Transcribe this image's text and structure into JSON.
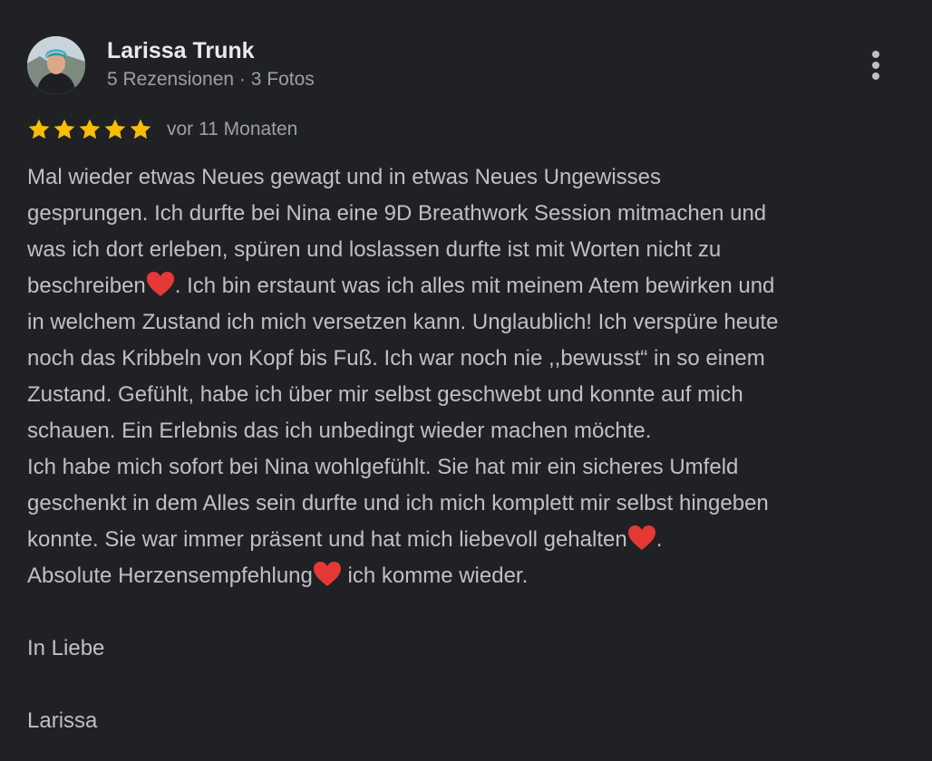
{
  "review": {
    "author_name": "Larissa Trunk",
    "author_meta": "5 Rezensionen · 3 Fotos",
    "rating": 5,
    "rating_max": 5,
    "date": "vor 11 Monaten",
    "avatar_icon": "person-photo-avatar",
    "menu_icon": "more-vert-icon",
    "star_color": "#fbbc04",
    "heart_color": "#e53935",
    "text_parts": [
      "Mal wieder etwas Neues gewagt und in etwas Neues Ungewisses\ngesprungen. Ich durfte bei Nina eine 9D Breathwork Session mitmachen und\nwas ich dort erleben, spüren und loslassen durfte ist mit Worten nicht zu\nbeschreiben",
      ". Ich bin erstaunt was ich alles mit meinem Atem bewirken und\nin welchem Zustand ich mich versetzen kann. Unglaublich! Ich verspüre heute\nnoch das Kribbeln von Kopf bis Fuß. Ich war noch nie ,,bewusst“ in so einem\nZustand. Gefühlt, habe ich über mir selbst geschwebt und konnte auf mich\nschauen. Ein Erlebnis das ich unbedingt wieder machen möchte.\nIch habe mich sofort bei Nina wohlgefühlt. Sie hat mir ein sicheres Umfeld\ngeschenkt in dem Alles sein durfte und ich mich komplett mir selbst hingeben\nkonnte. Sie war immer präsent und hat mich liebevoll gehalten",
      ".\nAbsolute Herzensempfehlung",
      " ich komme wieder.\n\nIn Liebe\n\nLarissa"
    ]
  }
}
